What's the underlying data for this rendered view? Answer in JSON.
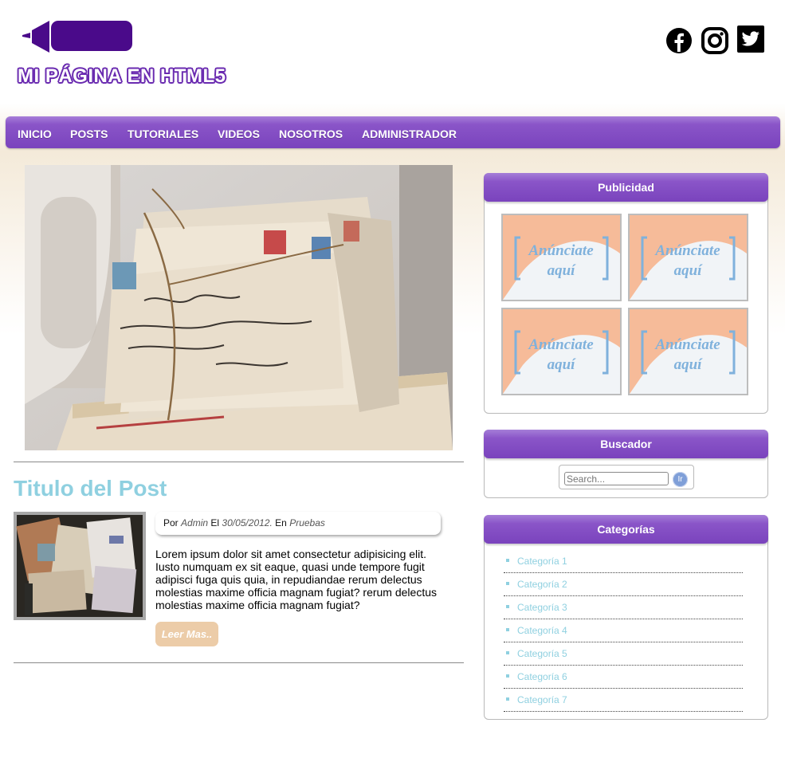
{
  "header": {
    "site_title": "MI PÁGINA EN HTML5",
    "social": [
      "facebook-icon",
      "instagram-icon",
      "twitter-icon"
    ]
  },
  "nav": {
    "items": [
      "INICIO",
      "POSTS",
      "TUTORIALES",
      "VIDEOS",
      "NOSOTROS",
      "ADMINISTRADOR"
    ]
  },
  "post": {
    "title": "Titulo del Post",
    "meta_prefix": "Por",
    "author": "Admin",
    "date_prefix": "El",
    "date": "30/05/2012.",
    "category_prefix": "En",
    "category": "Pruebas",
    "excerpt": "Lorem ipsum dolor sit amet consectetur adipisicing elit. Iusto numquam ex sit eaque, quasi unde tempore fugit adipisci fuga quis quia, in repudiandae rerum delectus molestias maxime officia magnam fugiat? rerum delectus molestias maxime officia magnam fugiat?",
    "read_more": "Leer Mas.."
  },
  "sidebar": {
    "ads": {
      "title": "Publicidad",
      "items": [
        {
          "line1": "Anúnciate",
          "line2": "aquí"
        },
        {
          "line1": "Anúnciate",
          "line2": "aquí"
        },
        {
          "line1": "Anúnciate",
          "line2": "aquí"
        },
        {
          "line1": "Anúnciate",
          "line2": "aquí"
        }
      ]
    },
    "search": {
      "title": "Buscador",
      "placeholder": "Search...",
      "button": "Ir"
    },
    "categories": {
      "title": "Categorías",
      "items": [
        "Categoría 1",
        "Categoría 2",
        "Categoría 3",
        "Categoría 4",
        "Categoría 5",
        "Categoría 6",
        "Categoría 7"
      ]
    }
  },
  "colors": {
    "accent": "#7a43bd",
    "link": "#8fd0e0",
    "button": "#ecccA8"
  }
}
